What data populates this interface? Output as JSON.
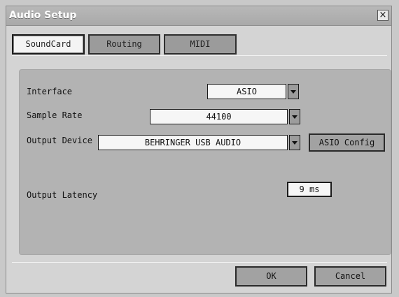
{
  "window": {
    "title": "Audio Setup",
    "close_glyph": "×"
  },
  "tabs": [
    {
      "label": "SoundCard",
      "active": true
    },
    {
      "label": "Routing",
      "active": false
    },
    {
      "label": "MIDI",
      "active": false
    }
  ],
  "soundcard": {
    "interface": {
      "label": "Interface",
      "value": "ASIO"
    },
    "sample_rate": {
      "label": "Sample Rate",
      "value": "44100"
    },
    "output_device": {
      "label": "Output Device",
      "value": "BEHRINGER USB AUDIO",
      "config_button": "ASIO Config"
    },
    "output_latency": {
      "label": "Output Latency",
      "value": "9 ms"
    }
  },
  "footer": {
    "ok_label": "OK",
    "cancel_label": "Cancel"
  },
  "icons": {
    "close": "close-icon",
    "dropdown": "chevron-down-icon"
  }
}
